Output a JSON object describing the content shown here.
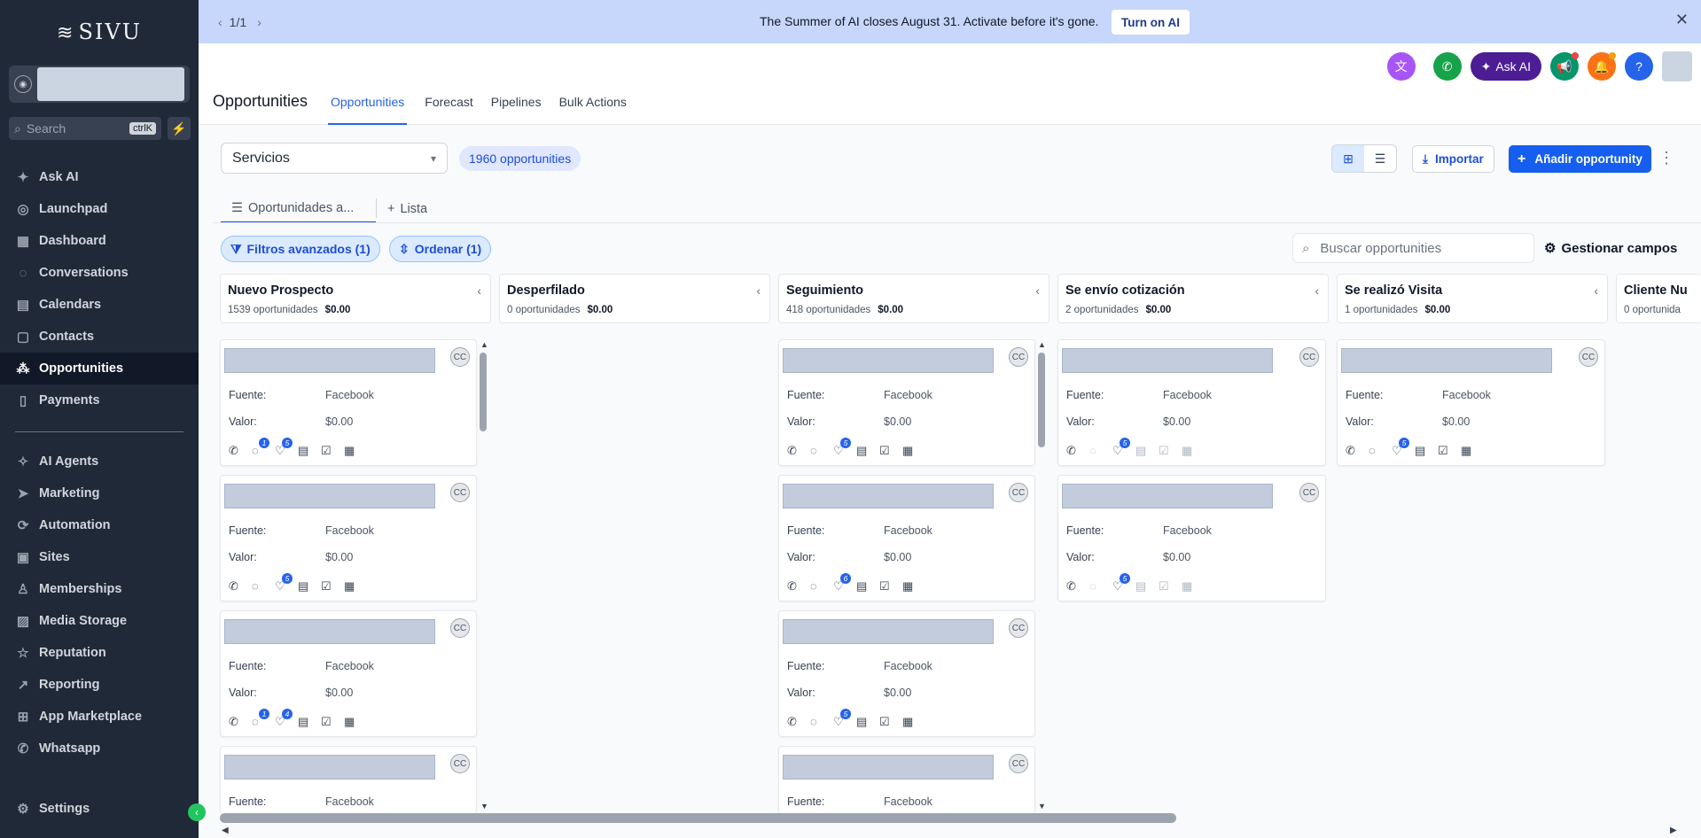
{
  "sidebar": {
    "logo_text": "SIVU",
    "search_placeholder": "Search",
    "search_shortcut": "ctrlK",
    "items": [
      {
        "label": "Ask AI",
        "icon": "sparkle-icon"
      },
      {
        "label": "Launchpad",
        "icon": "rocket-icon"
      },
      {
        "label": "Dashboard",
        "icon": "dashboard-icon"
      },
      {
        "label": "Conversations",
        "icon": "chat-icon"
      },
      {
        "label": "Calendars",
        "icon": "calendar-icon"
      },
      {
        "label": "Contacts",
        "icon": "contacts-icon"
      },
      {
        "label": "Opportunities",
        "icon": "opportunities-icon",
        "active": true
      },
      {
        "label": "Payments",
        "icon": "payments-icon"
      },
      {
        "label": "AI Agents",
        "icon": "ai-agents-icon"
      },
      {
        "label": "Marketing",
        "icon": "send-icon"
      },
      {
        "label": "Automation",
        "icon": "automation-icon"
      },
      {
        "label": "Sites",
        "icon": "sites-icon"
      },
      {
        "label": "Memberships",
        "icon": "memberships-icon"
      },
      {
        "label": "Media Storage",
        "icon": "media-icon"
      },
      {
        "label": "Reputation",
        "icon": "star-icon"
      },
      {
        "label": "Reporting",
        "icon": "trend-icon"
      },
      {
        "label": "App Marketplace",
        "icon": "grid-icon"
      },
      {
        "label": "Whatsapp",
        "icon": "whatsapp-icon"
      }
    ],
    "settings_label": "Settings"
  },
  "banner": {
    "pager": "1/1",
    "message": "The Summer of AI closes August 31. Activate before it's gone.",
    "cta": "Turn on AI"
  },
  "header": {
    "title": "Opportunities",
    "tabs": [
      "Opportunities",
      "Forecast",
      "Pipelines",
      "Bulk Actions"
    ],
    "ask_ai": "Ask AI"
  },
  "toolbar": {
    "pipeline": "Servicios",
    "count": "1960 opportunities",
    "import_label": "Importar",
    "add_label": "Añadir opportunity",
    "subtab_active": "Oportunidades a...",
    "subtab_add": "Lista",
    "filter_label": "Filtros avanzados (1)",
    "sort_label": "Ordenar (1)",
    "search_placeholder": "Buscar opportunities",
    "manage_fields": "Gestionar campos"
  },
  "card_labels": {
    "source": "Fuente:",
    "value": "Valor:",
    "avatar": "CC"
  },
  "columns": [
    {
      "name": "Nuevo Prospecto",
      "count": "1539 oportunidades",
      "amount": "$0.00",
      "cards": [
        {
          "source": "Facebook",
          "value": "$0.00",
          "badges": [
            "1",
            "5"
          ]
        },
        {
          "source": "Facebook",
          "value": "$0.00",
          "badges": [
            "",
            "5"
          ]
        },
        {
          "source": "Facebook",
          "value": "$0.00",
          "badges": [
            "1",
            "4"
          ]
        },
        {
          "source": "Facebook",
          "value": "",
          "badges": []
        }
      ]
    },
    {
      "name": "Desperfilado",
      "count": "0 oportunidades",
      "amount": "$0.00",
      "cards": []
    },
    {
      "name": "Seguimiento",
      "count": "418 oportunidades",
      "amount": "$0.00",
      "cards": [
        {
          "source": "Facebook",
          "value": "$0.00",
          "badges": [
            "",
            "5"
          ]
        },
        {
          "source": "Facebook",
          "value": "$0.00",
          "badges": [
            "",
            "6"
          ]
        },
        {
          "source": "Facebook",
          "value": "$0.00",
          "badges": [
            "",
            "5"
          ]
        },
        {
          "source": "Facebook",
          "value": "",
          "badges": []
        }
      ]
    },
    {
      "name": "Se envío cotización",
      "count": "2 oportunidades",
      "amount": "$0.00",
      "cards": [
        {
          "source": "Facebook",
          "value": "$0.00",
          "badges": [
            "",
            "5"
          ]
        },
        {
          "source": "Facebook",
          "value": "$0.00",
          "badges": [
            "",
            "5"
          ]
        }
      ]
    },
    {
      "name": "Se realizó Visita",
      "count": "1 oportunidades",
      "amount": "$0.00",
      "cards": [
        {
          "source": "Facebook",
          "value": "$0.00",
          "badges": [
            "",
            "5"
          ]
        }
      ]
    },
    {
      "name": "Cliente Nu",
      "count": "0 oportunida",
      "amount": "",
      "cards": []
    }
  ]
}
